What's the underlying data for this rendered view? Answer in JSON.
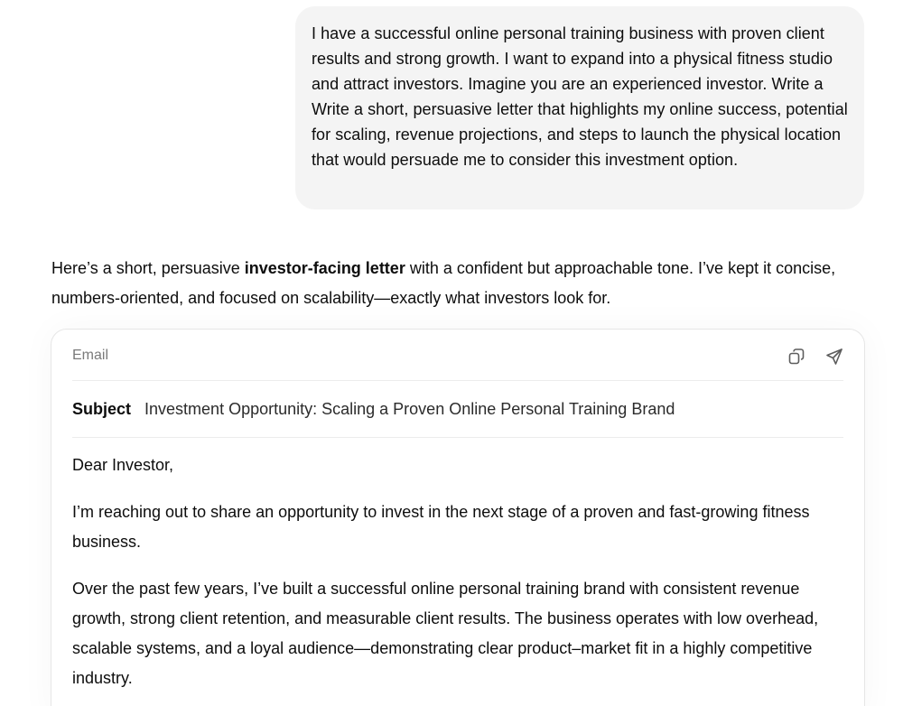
{
  "user_message": {
    "text": "I have a successful online personal training business with proven client results and strong growth. I want to expand into a physical fitness studio and attract investors. Imagine you are an experienced investor. Write a Write a short, persuasive letter that highlights my online success, potential for scaling, revenue projections, and steps to launch the physical location that would persuade me to consider this investment option."
  },
  "assistant": {
    "intro_before": "Here’s a short, persuasive ",
    "intro_bold": "investor-facing letter",
    "intro_after": " with a confident but approachable tone. I’ve kept it concise, numbers-oriented, and focused on scalability—exactly what investors look for."
  },
  "email_card": {
    "label": "Email",
    "icons": {
      "copy": "copy-icon",
      "send": "send-icon"
    },
    "subject_label": "Subject",
    "subject_value": "Investment Opportunity: Scaling a Proven Online Personal Training Brand",
    "body": [
      "Dear Investor,",
      "I’m reaching out to share an opportunity to invest in the next stage of a proven and fast-growing fitness business.",
      "Over the past few years, I’ve built a successful online personal training brand with consistent revenue growth, strong client retention, and measurable client results. The business operates with low overhead, scalable systems, and a loyal audience—demonstrating clear product–market fit in a highly competitive industry."
    ]
  }
}
